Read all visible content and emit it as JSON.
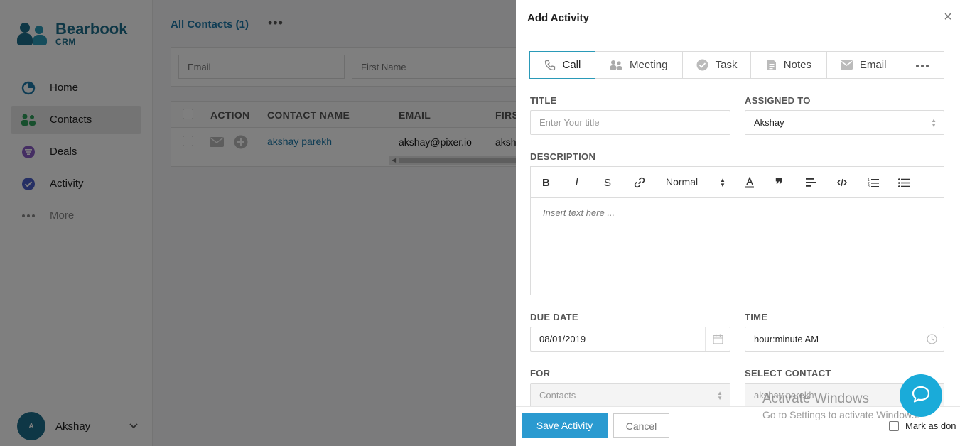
{
  "brand": {
    "name": "Bearbook",
    "sub": "CRM"
  },
  "sidebar": {
    "items": [
      {
        "label": "Home",
        "icon": "pie-chart-icon",
        "active": false
      },
      {
        "label": "Contacts",
        "icon": "people-icon",
        "active": true
      },
      {
        "label": "Deals",
        "icon": "filter-icon",
        "active": false
      },
      {
        "label": "Activity",
        "icon": "check-circle-icon",
        "active": false
      },
      {
        "label": "More",
        "icon": "more-dots-icon",
        "active": false
      }
    ],
    "user": {
      "initial": "A",
      "name": "Akshay"
    }
  },
  "main": {
    "title": "All Contacts (1)",
    "filters": {
      "email_placeholder": "Email",
      "first_name_placeholder": "First Name"
    },
    "table": {
      "columns": [
        "ACTION",
        "CONTACT NAME",
        "EMAIL",
        "FIRS"
      ],
      "rows": [
        {
          "name": "akshay parekh",
          "email": "akshay@pixer.io",
          "first": "aksh"
        }
      ]
    }
  },
  "panel": {
    "title": "Add Activity",
    "close": "×",
    "tabs": [
      {
        "label": "Call",
        "icon": "phone-icon",
        "active": true
      },
      {
        "label": "Meeting",
        "icon": "people-icon",
        "active": false
      },
      {
        "label": "Task",
        "icon": "check-circle-icon",
        "active": false
      },
      {
        "label": "Notes",
        "icon": "document-icon",
        "active": false
      },
      {
        "label": "Email",
        "icon": "envelope-icon",
        "active": false
      },
      {
        "label": "",
        "icon": "more-dots-icon",
        "active": false
      }
    ],
    "title_field": {
      "label": "TITLE",
      "placeholder": "Enter Your title"
    },
    "assigned_to": {
      "label": "ASSIGNED TO",
      "value": "Akshay"
    },
    "description": {
      "label": "DESCRIPTION",
      "format": "Normal",
      "placeholder": "Insert text here ..."
    },
    "due_date": {
      "label": "DUE DATE",
      "value": "08/01/2019"
    },
    "time": {
      "label": "TIME",
      "value": "hour:minute AM"
    },
    "for": {
      "label": "FOR",
      "value": "Contacts"
    },
    "select_contact": {
      "label": "SELECT CONTACT",
      "value": "akshay parekh"
    },
    "save_label": "Save Activity",
    "cancel_label": "Cancel",
    "mark_done_label": "Mark as don"
  },
  "watermark": {
    "line1": "Activate Windows",
    "line2": "Go to Settings to activate Windows."
  },
  "colors": {
    "brand": "#1c6e8c",
    "accent": "#2a9ad0",
    "chat": "#1aabd9",
    "link": "#1c78a8"
  }
}
